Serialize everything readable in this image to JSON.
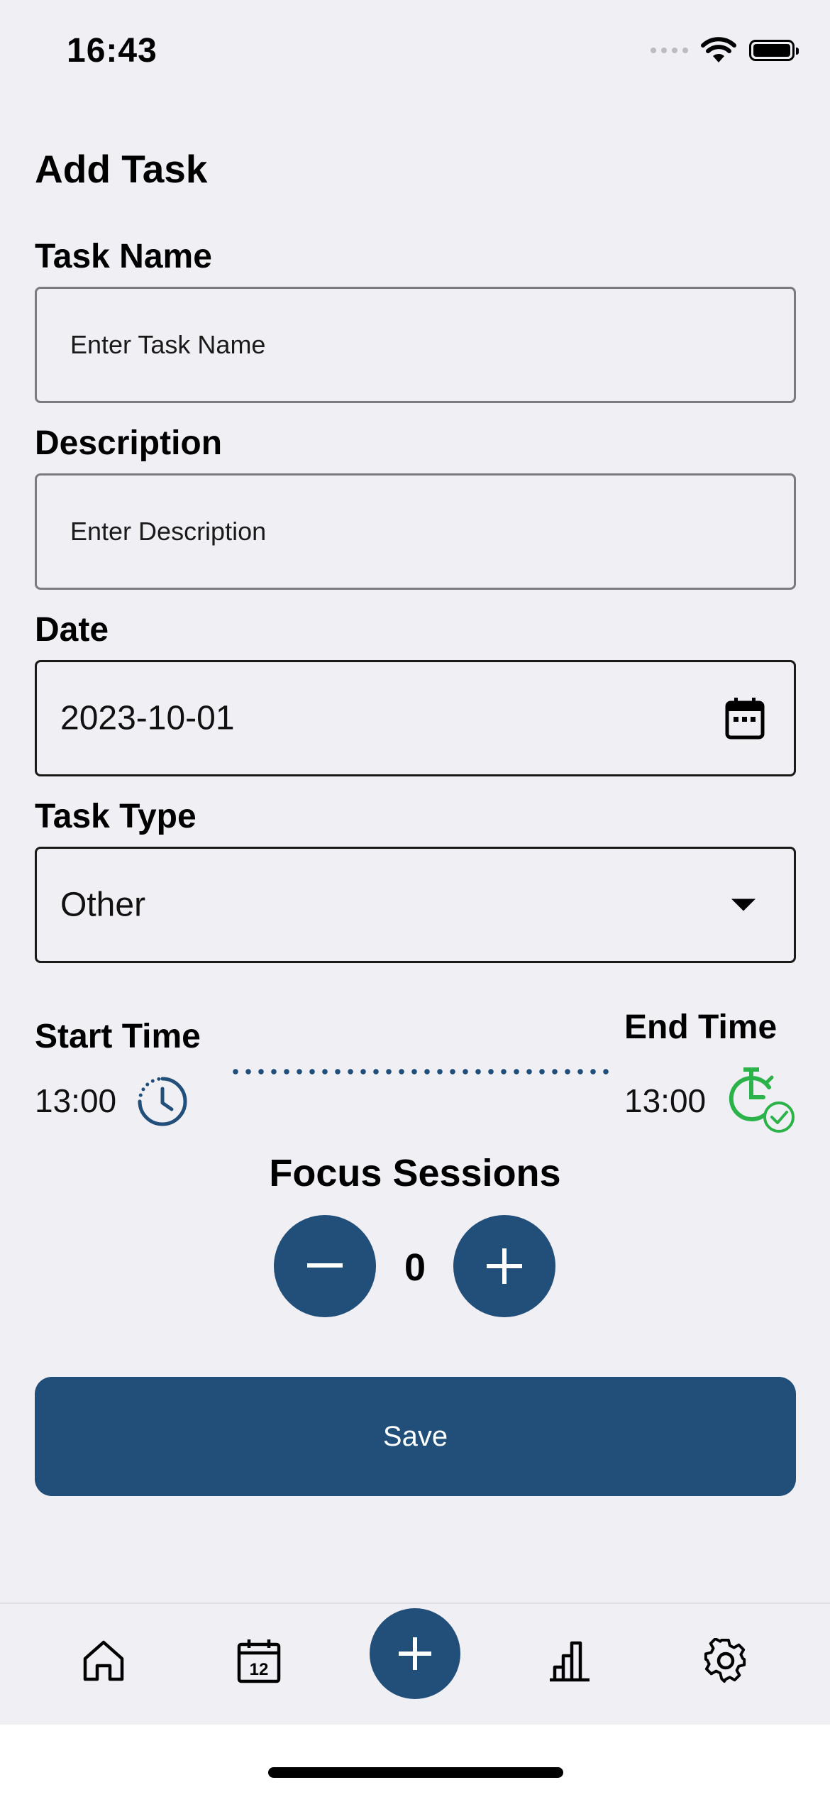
{
  "status": {
    "time": "16:43"
  },
  "header": {
    "title": "Add Task"
  },
  "form": {
    "task_name": {
      "label": "Task Name",
      "placeholder": "Enter Task Name"
    },
    "description": {
      "label": "Description",
      "placeholder": "Enter Description"
    },
    "date": {
      "label": "Date",
      "value": "2023-10-01"
    },
    "task_type": {
      "label": "Task Type",
      "value": "Other"
    },
    "start_time": {
      "label": "Start Time",
      "value": "13:00"
    },
    "end_time": {
      "label": "End Time",
      "value": "13:00"
    },
    "focus": {
      "title": "Focus Sessions",
      "count": "0"
    },
    "save_label": "Save"
  },
  "colors": {
    "primary": "#214f7a",
    "background": "#f0eff4",
    "end_time_icon": "#2bb34a"
  },
  "tabbar": {
    "items": [
      {
        "icon": "home-icon"
      },
      {
        "icon": "calendar-icon"
      },
      {
        "icon": "plus-icon"
      },
      {
        "icon": "stats-icon"
      },
      {
        "icon": "settings-icon"
      }
    ]
  }
}
